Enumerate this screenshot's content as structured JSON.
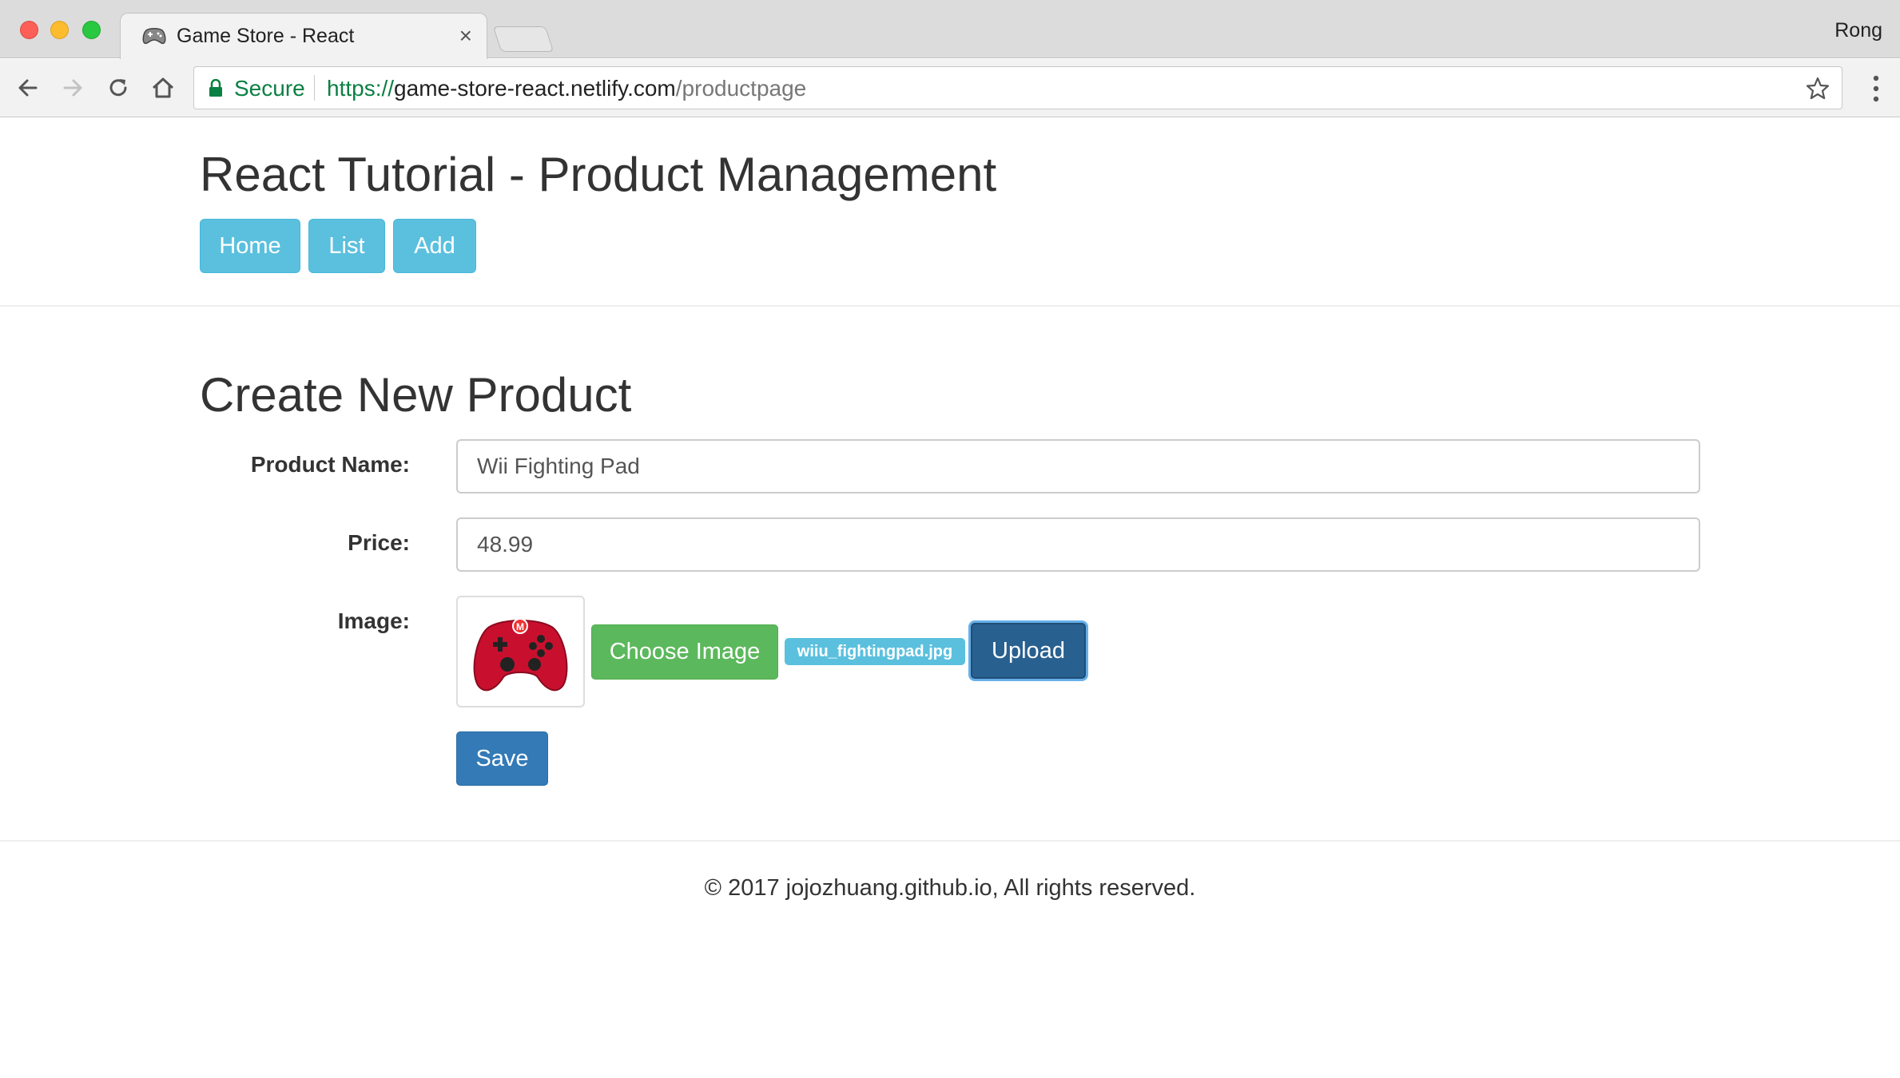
{
  "browser": {
    "tab_title": "Game Store - React",
    "tab_close": "×",
    "profile_name": "Rong",
    "secure_label": "Secure",
    "url_scheme": "https://",
    "url_host": "game-store-react.netlify.com",
    "url_path": "/productpage",
    "icons": [
      "back-arrow-icon",
      "forward-arrow-icon",
      "reload-icon",
      "home-icon",
      "lock-icon",
      "bookmark-star-icon",
      "menu-icon"
    ]
  },
  "header": {
    "title": "React Tutorial - Product Management",
    "nav": [
      "Home",
      "List",
      "Add"
    ]
  },
  "form": {
    "title": "Create New Product",
    "product_name_label": "Product Name:",
    "product_name_value": "Wii Fighting Pad",
    "price_label": "Price:",
    "price_value": "48.99",
    "image_label": "Image:",
    "choose_image_label": "Choose Image",
    "file_name": "wiiu_fightingpad.jpg",
    "upload_label": "Upload",
    "save_label": "Save"
  },
  "footer": {
    "text": "© 2017 jojozhuang.github.io, All rights reserved."
  },
  "colors": {
    "info": "#5bc0de",
    "success": "#5cb85c",
    "primary": "#337ab7",
    "primary_active": "#286090",
    "secure_green": "#0b8043"
  }
}
